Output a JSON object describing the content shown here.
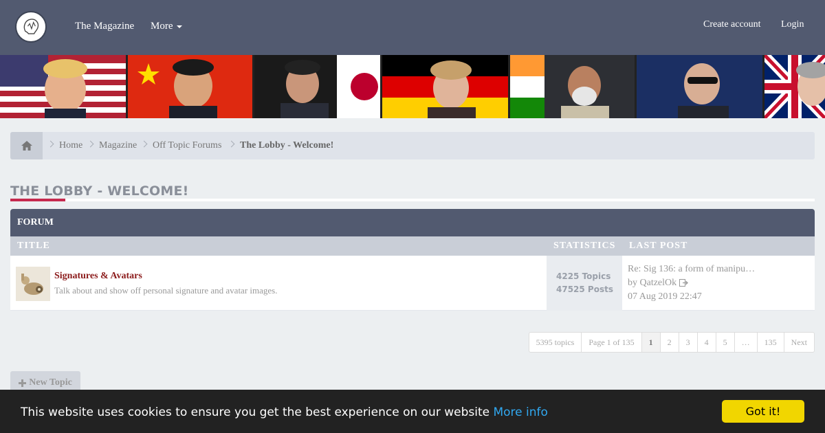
{
  "nav": {
    "magazine_label": "The Magazine",
    "more_label": "More",
    "create_account_label": "Create account",
    "login_label": "Login"
  },
  "breadcrumb": {
    "items": [
      "Home",
      "Magazine",
      "Off Topic Forums",
      "The Lobby - Welcome!"
    ]
  },
  "page": {
    "title": "THE LOBBY - WELCOME!"
  },
  "forum_table": {
    "header": "FORUM",
    "columns": [
      "TITLE",
      "STATISTICS",
      "LAST POST"
    ],
    "rows": [
      {
        "name": "Signatures & Avatars",
        "description": "Talk about and show off personal signature and avatar images.",
        "topics": "4225 Topics",
        "posts": "47525 Posts",
        "last_post_title": "Re: Sig 136: a form of manipu…",
        "last_post_by": "by",
        "last_post_user": "QatzelOk",
        "last_post_date": "07 Aug 2019 22:47"
      }
    ]
  },
  "pagination": {
    "topics": "5395 topics",
    "page_info": "Page 1 of 135",
    "pages": [
      "1",
      "2",
      "3",
      "4",
      "5",
      "…",
      "135"
    ],
    "next": "Next"
  },
  "new_topic_label": "New Topic",
  "cookie": {
    "text": "This website uses cookies to ensure you get the best experience on our website",
    "more_info": "More info",
    "button": "Got it!"
  },
  "colors": {
    "nav_bg": "#525a70",
    "accent": "#c62a4e",
    "forum_link": "#8b1a1a",
    "cookie_button": "#f1d600",
    "cookie_link": "#31a8f0"
  },
  "icons": [
    "logo-icon",
    "caret-down-icon",
    "home-icon",
    "chevron-right-icon",
    "plus-icon",
    "external-link-icon"
  ]
}
